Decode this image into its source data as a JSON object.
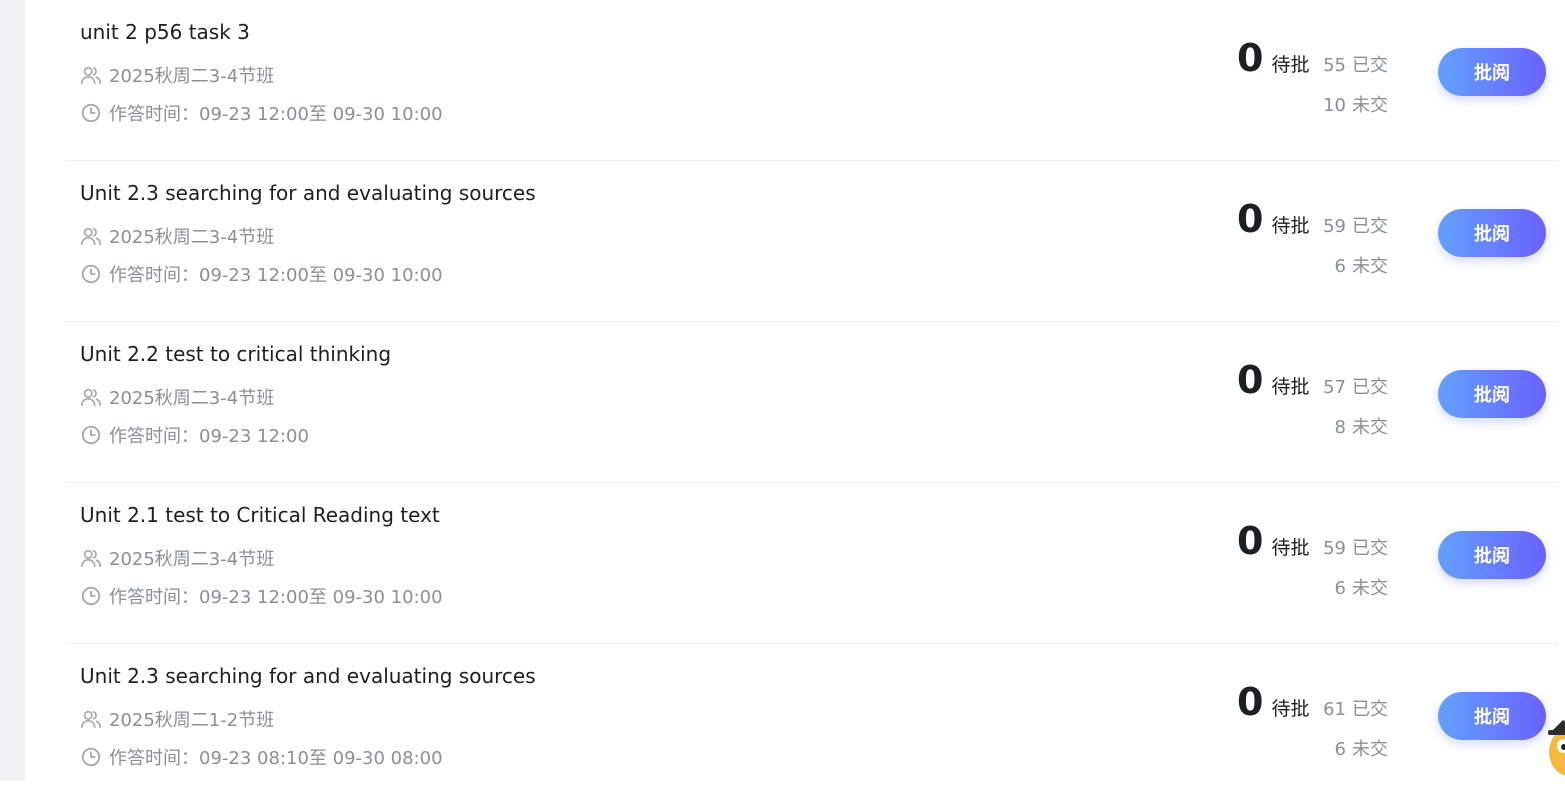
{
  "assignments": [
    {
      "title": "unit 2 p56 task 3",
      "class_name": "2025秋周二3-4节班",
      "time": "作答时间：09-23 12:00至 09-30 10:00",
      "pending_count": "0",
      "pending_label": "待批",
      "submitted_count": "55",
      "submitted_label": "已交",
      "unsubmitted_count": "10",
      "unsubmitted_label": "未交",
      "action_label": "批阅"
    },
    {
      "title": "Unit 2.3 searching for and evaluating sources",
      "class_name": "2025秋周二3-4节班",
      "time": "作答时间：09-23 12:00至 09-30 10:00",
      "pending_count": "0",
      "pending_label": "待批",
      "submitted_count": "59",
      "submitted_label": "已交",
      "unsubmitted_count": "6",
      "unsubmitted_label": "未交",
      "action_label": "批阅"
    },
    {
      "title": "Unit 2.2 test to critical thinking",
      "class_name": "2025秋周二3-4节班",
      "time": "作答时间：09-23 12:00",
      "pending_count": "0",
      "pending_label": "待批",
      "submitted_count": "57",
      "submitted_label": "已交",
      "unsubmitted_count": "8",
      "unsubmitted_label": "未交",
      "action_label": "批阅"
    },
    {
      "title": "Unit 2.1 test to Critical Reading text",
      "class_name": "2025秋周二3-4节班",
      "time": "作答时间：09-23 12:00至 09-30 10:00",
      "pending_count": "0",
      "pending_label": "待批",
      "submitted_count": "59",
      "submitted_label": "已交",
      "unsubmitted_count": "6",
      "unsubmitted_label": "未交",
      "action_label": "批阅"
    },
    {
      "title": "Unit 2.3 searching for and evaluating sources",
      "class_name": "2025秋周二1-2节班",
      "time": "作答时间：09-23 08:10至 09-30 08:00",
      "pending_count": "0",
      "pending_label": "待批",
      "submitted_count": "61",
      "submitted_label": "已交",
      "unsubmitted_count": "6",
      "unsubmitted_label": "未交",
      "action_label": "批阅"
    }
  ],
  "colors": {
    "button_gradient_start": "#62a0ff",
    "button_gradient_end": "#6a62ff",
    "muted_text": "#8a8f99",
    "primary_text": "#1c1f23"
  },
  "icons": {
    "class": "users-icon",
    "time": "clock-icon",
    "assistant": "mascot-icon"
  }
}
